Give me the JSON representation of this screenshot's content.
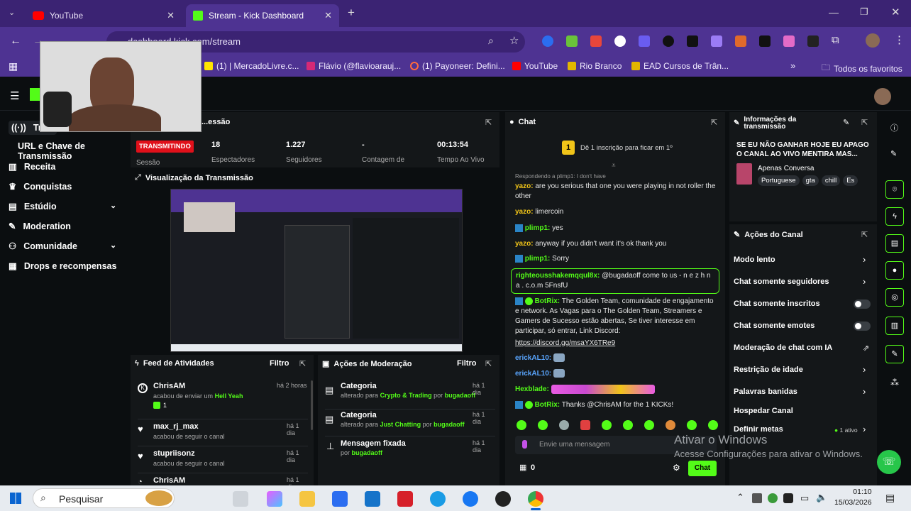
{
  "browser": {
    "tabs": [
      {
        "label": "YouTube"
      },
      {
        "label": "Stream - Kick Dashboard"
      }
    ],
    "url": "dashboard.kick.com/stream",
    "bookmarks": [
      "(1) | MercadoLivre.c...",
      "Flávio (@flavioarauj...",
      "(1) Payoneer: Defini...",
      "YouTube",
      "Rio Branco",
      "EAD Cursos de Trân..."
    ],
    "all_bookmarks": "Todos os favoritos"
  },
  "sidebar": {
    "items": [
      {
        "label": "Tra..."
      },
      {
        "label": "URL e Chave de Transmissão"
      },
      {
        "label": "Receita"
      },
      {
        "label": "Conquistas"
      },
      {
        "label": "Estúdio"
      },
      {
        "label": "Moderation"
      },
      {
        "label": "Comunidade"
      },
      {
        "label": "Drops e recompensas"
      }
    ]
  },
  "session": {
    "title": "...essão",
    "status": "TRANSMITINDO",
    "status_sub": "Sessão",
    "stats": [
      {
        "value": "18",
        "label": "Espectadores"
      },
      {
        "value": "1.227",
        "label": "Seguidores"
      },
      {
        "value": "-",
        "label": "Contagem de"
      },
      {
        "value": "00:13:54",
        "label": "Tempo Ao Vivo"
      }
    ]
  },
  "preview": {
    "title": "Visualização da Transmissão"
  },
  "feed": {
    "title": "Feed de Atividades",
    "filter": "Filtro",
    "items": [
      {
        "user": "ChrisAM",
        "text": "acabou de enviar um",
        "extra": "Hell Yeah",
        "count": "1",
        "time": "há 2 horas"
      },
      {
        "user": "max_rj_max",
        "text": "acabou de seguir o canal",
        "time": "há 1 dia"
      },
      {
        "user": "stupriisonz",
        "text": "acabou de seguir o canal",
        "time": "há 1 dia"
      },
      {
        "user": "ChrisAM",
        "text": "",
        "time": "há 1 dia"
      }
    ]
  },
  "modactions": {
    "title": "Ações de Moderação",
    "filter": "Filtro",
    "items": [
      {
        "title": "Categoria",
        "pre": "alterado para",
        "value": "Crypto & Trading",
        "by": "por",
        "user": "bugadaoff",
        "time": "há 1 dia"
      },
      {
        "title": "Categoria",
        "pre": "alterado para",
        "value": "Just Chatting",
        "by": "por",
        "user": "bugadaoff",
        "time": "há 1 dia"
      },
      {
        "title": "Mensagem fixada",
        "pre": "por",
        "value": "",
        "by": "",
        "user": "bugadaoff",
        "time": "há 1 dia"
      }
    ]
  },
  "chat": {
    "title": "Chat",
    "banner": "Dê 1 inscrição para ficar em 1º",
    "reply": "Respondendo a plimp1: I don't have",
    "messages": [
      {
        "user": "yazo:",
        "text": "are you serious that one you were playing in not roller the other"
      },
      {
        "user": "yazo:",
        "text": "limercoin"
      },
      {
        "user": "plimp1:",
        "text": "yes"
      },
      {
        "user": "yazo:",
        "text": "anyway if you didn't want it's ok thank you"
      },
      {
        "user": "plimp1:",
        "text": "Sorry"
      },
      {
        "user": "righteousshakemqqul8x:",
        "text": "@bugadaoff come to us - n e z h n a . c.o.m 5FnsfU"
      },
      {
        "user": "BotRix:",
        "text": "The Golden Team, comunidade de engajamento e network. As Vagas para o The Golden Team, Streamers e Gamers de Sucesso estão abertas, Se tiver interesse em participar, só entrar, Link Discord:"
      },
      {
        "user": "",
        "text": "https://discord.gg/msaYX6TRe9"
      },
      {
        "user": "erickAL10:",
        "text": ""
      },
      {
        "user": "erickAL10:",
        "text": ""
      },
      {
        "user": "Hexblade:",
        "text": ""
      },
      {
        "user": "BotRix:",
        "text": "Thanks @ChrisAM for the 1 KICKs!"
      }
    ],
    "input_placeholder": "Envie uma mensagem",
    "count": "0",
    "send": "Chat"
  },
  "info": {
    "title": "Informações da transmissão",
    "stream_title": "SE EU NÃO GANHAR HOJE EU APAGO O CANAL AO VIVO MENTIRA MAS...",
    "category": "Apenas Conversa",
    "tags": [
      "Portuguese",
      "gta",
      "chill",
      "Es"
    ]
  },
  "channel_actions": {
    "title": "Ações do Canal",
    "items": [
      {
        "label": "Modo lento",
        "kind": "arrow"
      },
      {
        "label": "Chat somente seguidores",
        "kind": "arrow"
      },
      {
        "label": "Chat somente inscritos",
        "kind": "toggle"
      },
      {
        "label": "Chat somente emotes",
        "kind": "toggle"
      },
      {
        "label": "Moderação de chat com IA",
        "kind": "link"
      },
      {
        "label": "Restrição de idade",
        "kind": "arrow"
      },
      {
        "label": "Palavras banidas",
        "kind": "arrow"
      },
      {
        "label": "Hospedar Canal",
        "kind": "none"
      },
      {
        "label": "Definir metas",
        "kind": "arrow",
        "badge": "1 ativo"
      }
    ]
  },
  "watermark": {
    "line1": "Ativar o Windows",
    "line2": "Acesse Configurações para ativar o Windows."
  },
  "taskbar": {
    "search": "Pesquisar",
    "time": "01:10",
    "date": "15/03/2026"
  },
  "colors": {
    "kick_green": "#53fc18",
    "purple": "#4e3392",
    "bg": "#0b0e10",
    "panel": "#141719"
  }
}
